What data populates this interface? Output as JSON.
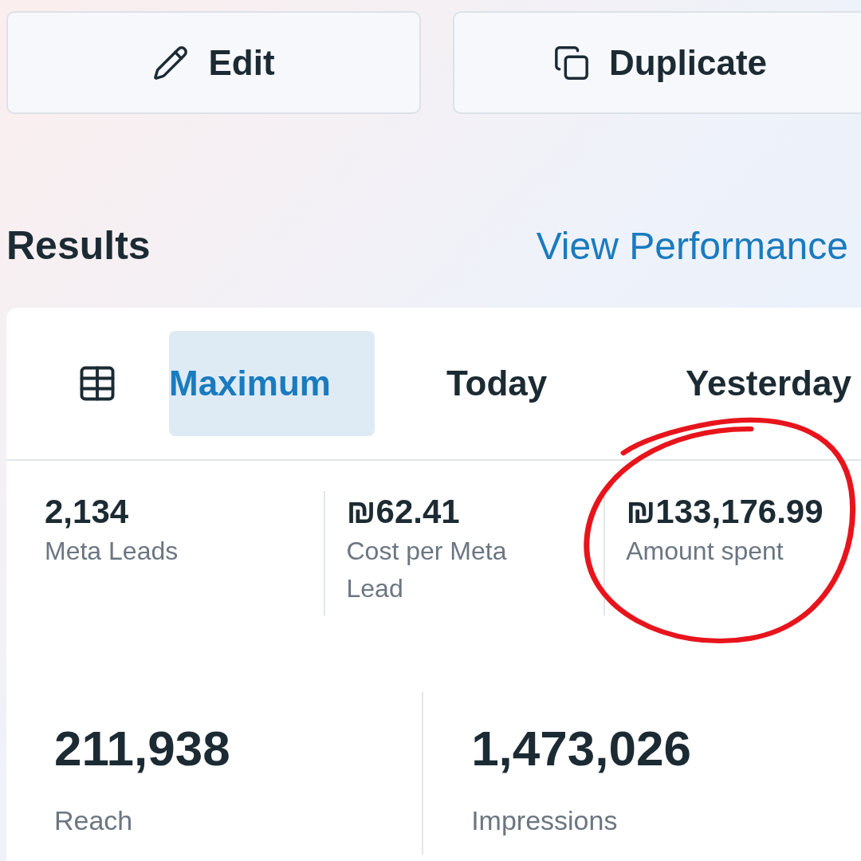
{
  "actions": [
    {
      "kind": "edit",
      "label": "Edit"
    },
    {
      "kind": "duplicate",
      "label": "Duplicate"
    }
  ],
  "section": {
    "title": "Results",
    "link": "View Performance"
  },
  "tabs": [
    {
      "label": "Maximum",
      "selected": true
    },
    {
      "label": "Today",
      "selected": false
    },
    {
      "label": "Yesterday",
      "selected": false
    }
  ],
  "metrics": [
    {
      "value": "2,134",
      "label": "Meta Leads"
    },
    {
      "value": "₪62.41",
      "label": "Cost per Meta Lead"
    },
    {
      "value": "₪133,176.99",
      "label": "Amount spent"
    }
  ],
  "highlights": [
    {
      "value": "211,938",
      "label": "Reach"
    },
    {
      "value": "1,473,026",
      "label": "Impressions"
    }
  ]
}
